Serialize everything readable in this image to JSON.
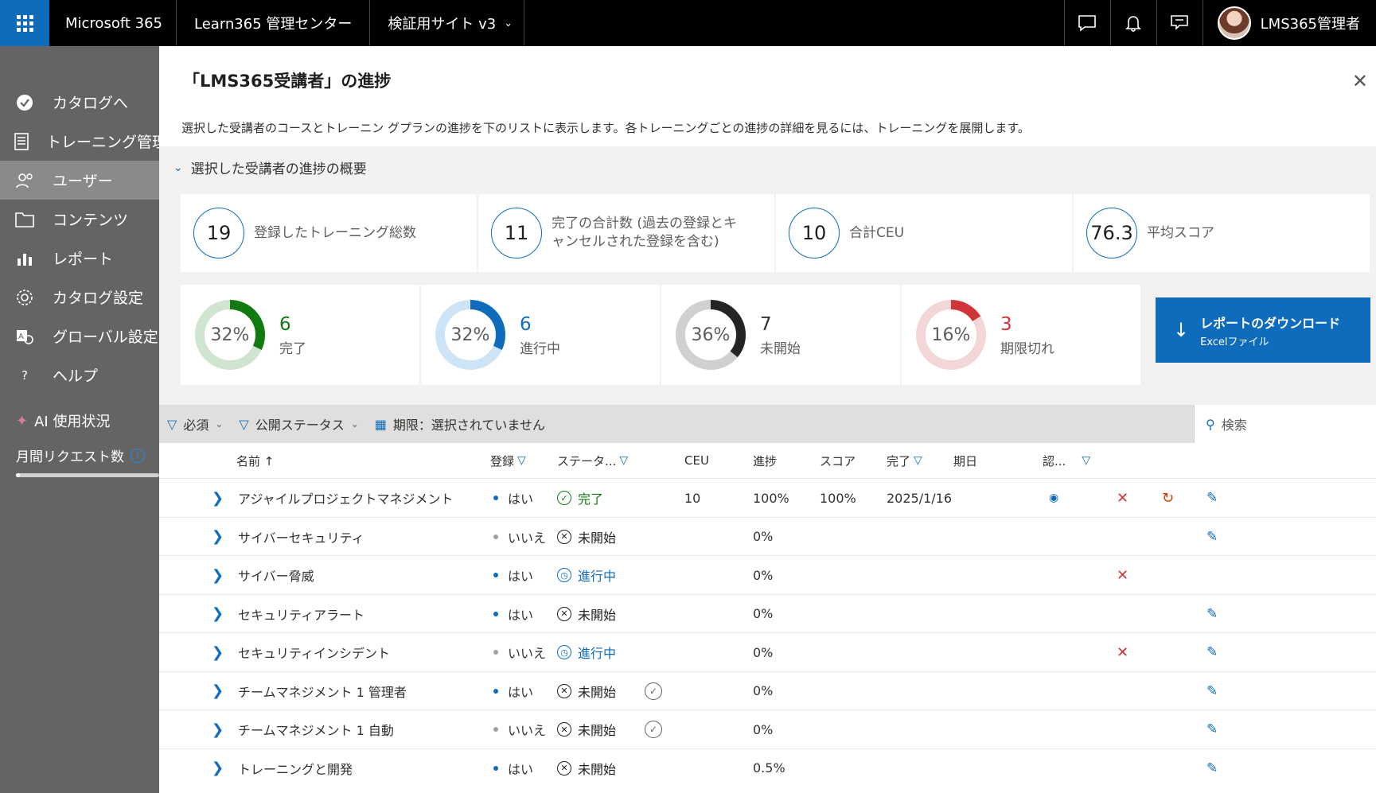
{
  "topbar": {
    "brand": "Microsoft 365",
    "app": "Learn365 管理センター",
    "site": "検証用サイト v3",
    "user": "LMS365管理者",
    "icons": [
      "waffle-icon",
      "chat-icon",
      "bell-icon",
      "feedback-icon"
    ]
  },
  "sidebar": {
    "items": [
      {
        "label": "カタログへ",
        "icon": "catalog-check-icon",
        "active": false
      },
      {
        "label": "トレーニング管理",
        "icon": "document-icon",
        "active": false
      },
      {
        "label": "ユーザー",
        "icon": "users-icon",
        "active": true
      },
      {
        "label": "コンテンツ",
        "icon": "folder-icon",
        "active": false
      },
      {
        "label": "レポート",
        "icon": "bar-chart-icon",
        "active": false
      },
      {
        "label": "カタログ設定",
        "icon": "gear-icon",
        "active": false
      },
      {
        "label": "グローバル設定",
        "icon": "global-settings-icon",
        "active": false
      },
      {
        "label": "ヘルプ",
        "icon": "help-icon",
        "active": false
      }
    ],
    "ai_title": "AI 使用状況",
    "ai_requests": "月間リクエスト数",
    "ai_progress": 0.03
  },
  "panel": {
    "title": "「LMS365受講者」の進捗",
    "description": "選択した受講者のコースとトレーニン グプランの進捗を下のリストに表示します。各トレーニングごとの進捗の詳細を見るには、トレーニングを展開します。",
    "summary_header": "選択した受講者の進捗の概要",
    "stats": [
      {
        "value": "19",
        "label": "登録したトレーニング総数"
      },
      {
        "value": "11",
        "label": "完了の合計数 (過去の登録とキャンセルされた登録を含む)"
      },
      {
        "value": "10",
        "label": "合計CEU"
      },
      {
        "value": "76.3",
        "label": "平均スコア"
      }
    ],
    "donuts": [
      {
        "pct_label": "32%",
        "fraction": 0.32,
        "count": "6",
        "label": "完了",
        "color": "#107c10",
        "track": "#cfe5cf",
        "count_color": "#107c10"
      },
      {
        "pct_label": "32%",
        "fraction": 0.32,
        "count": "6",
        "label": "進行中",
        "color": "#0f6cbd",
        "track": "#cde4f7",
        "count_color": "#0f6cbd"
      },
      {
        "pct_label": "36%",
        "fraction": 0.36,
        "count": "7",
        "label": "未開始",
        "color": "#252423",
        "track": "#d2d0ce",
        "count_color": "#323130"
      },
      {
        "pct_label": "16%",
        "fraction": 0.16,
        "count": "3",
        "label": "期限切れ",
        "color": "#d13438",
        "track": "#f3d6d7",
        "count_color": "#d13438"
      }
    ],
    "download": {
      "label": "レポートのダウンロード",
      "sub": "Excelファイル"
    }
  },
  "filters": {
    "required": "必須",
    "publish_status": "公開ステータス",
    "due": "期限：選択されていません",
    "search_placeholder": "検索"
  },
  "table": {
    "headers": {
      "name": "名前 ↑",
      "enrolled": "登録",
      "status": "ステータ...",
      "ceu": "CEU",
      "progress": "進捗",
      "score": "スコア",
      "completed": "完了",
      "due": "期日",
      "cert": "認..."
    },
    "rows": [
      {
        "name": "アジャイルプロジェクトマネジメント",
        "enrolled": "はい",
        "enrolled_yes": true,
        "status": "完了",
        "status_kind": "done",
        "cert": false,
        "ceu": "10",
        "progress": "100%",
        "score": "100%",
        "completed": "2025/1/16",
        "view": true,
        "remove": true,
        "reset": true,
        "edit": true
      },
      {
        "name": "サイバーセキュリティ",
        "enrolled": "いいえ",
        "enrolled_yes": false,
        "status": "未開始",
        "status_kind": "none",
        "cert": false,
        "ceu": "",
        "progress": "0%",
        "score": "",
        "completed": "",
        "view": false,
        "remove": false,
        "reset": false,
        "edit": true
      },
      {
        "name": "サイバー脅威",
        "enrolled": "はい",
        "enrolled_yes": true,
        "status": "進行中",
        "status_kind": "prog",
        "cert": false,
        "ceu": "",
        "progress": "0%",
        "score": "",
        "completed": "",
        "view": false,
        "remove": true,
        "reset": false,
        "edit": false
      },
      {
        "name": "セキュリティアラート",
        "enrolled": "はい",
        "enrolled_yes": true,
        "status": "未開始",
        "status_kind": "none",
        "cert": false,
        "ceu": "",
        "progress": "0%",
        "score": "",
        "completed": "",
        "view": false,
        "remove": false,
        "reset": false,
        "edit": true
      },
      {
        "name": "セキュリティインシデント",
        "enrolled": "いいえ",
        "enrolled_yes": false,
        "status": "進行中",
        "status_kind": "prog",
        "cert": false,
        "ceu": "",
        "progress": "0%",
        "score": "",
        "completed": "",
        "view": false,
        "remove": true,
        "reset": false,
        "edit": true
      },
      {
        "name": "チームマネジメント 1 管理者",
        "enrolled": "はい",
        "enrolled_yes": true,
        "status": "未開始",
        "status_kind": "none",
        "cert": true,
        "ceu": "",
        "progress": "0%",
        "score": "",
        "completed": "",
        "view": false,
        "remove": false,
        "reset": false,
        "edit": true
      },
      {
        "name": "チームマネジメント 1 自動",
        "enrolled": "いいえ",
        "enrolled_yes": false,
        "status": "未開始",
        "status_kind": "none",
        "cert": true,
        "ceu": "",
        "progress": "0%",
        "score": "",
        "completed": "",
        "view": false,
        "remove": false,
        "reset": false,
        "edit": true
      },
      {
        "name": "トレーニングと開発",
        "enrolled": "はい",
        "enrolled_yes": true,
        "status": "未開始",
        "status_kind": "none",
        "cert": false,
        "ceu": "",
        "progress": "0.5%",
        "score": "",
        "completed": "",
        "view": false,
        "remove": false,
        "reset": false,
        "edit": true
      }
    ]
  }
}
